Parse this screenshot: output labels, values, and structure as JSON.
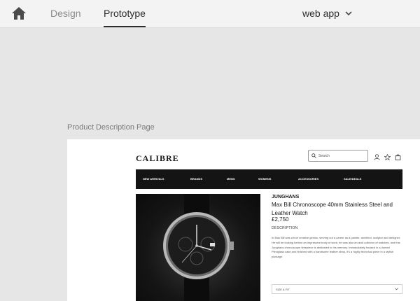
{
  "topbar": {
    "icons": {
      "home": "home-icon",
      "device_chevron": "chevron-down-icon"
    },
    "tabs": [
      {
        "label": "Design",
        "active": false
      },
      {
        "label": "Prototype",
        "active": true
      }
    ],
    "device_select": "web app"
  },
  "artboard": {
    "label": "Product Description Page",
    "site": {
      "logo": "CALIBRE",
      "search": {
        "value": "Search",
        "icon": "search-icon"
      },
      "header_icons": [
        "user-icon",
        "star-icon",
        "shopping-bag-icon"
      ],
      "nav": [
        "NEW ARRIVALS",
        "BRANDS",
        "MENS",
        "WOMENS",
        "ACCESSORIES",
        "SALE/DEALS"
      ],
      "product": {
        "brand": "JUNGHANS",
        "title": "Max Bill Chronoscope 40mm Stainless Steel and Leather Watch",
        "price": "£2,750",
        "description_heading": "DESCRIPTION",
        "description": "In Max Bill was a true creative genius, serving out a career as a painter, architect, sculptor and designer. He will be looking behind an impressive body of work; he was also an avid collector of watches, and this Junghans chronoscope timepiece is dedicated to his memory. Immaculately housed in a domed Plexiglass case and finished with a handsome leather strap, it's a highly technical piece in a stylish package.",
        "size_select": "SIZE & FIT"
      }
    }
  },
  "colors": {
    "canvas": "#e6e6e6",
    "topbar": "#f3f3f3",
    "nav_bg": "#141414",
    "text_dark": "#2c2c2c",
    "text_muted": "#8a8a8a"
  }
}
